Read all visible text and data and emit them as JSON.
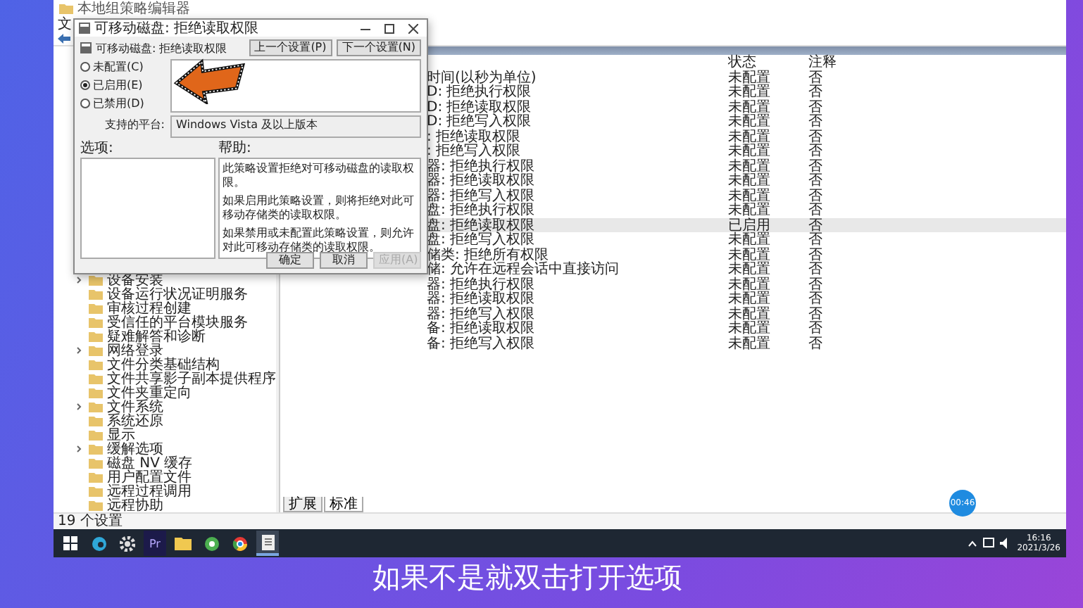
{
  "main_window": {
    "title": "本地组策略编辑器",
    "menu": [
      "文"
    ],
    "tree": [
      {
        "label": "设备安装",
        "expandable": true
      },
      {
        "label": "设备运行状况证明服务",
        "expandable": false
      },
      {
        "label": "审核过程创建",
        "expandable": false
      },
      {
        "label": "受信任的平台模块服务",
        "expandable": false
      },
      {
        "label": "疑难解答和诊断",
        "expandable": false
      },
      {
        "label": "网络登录",
        "expandable": true
      },
      {
        "label": "文件分类基础结构",
        "expandable": false
      },
      {
        "label": "文件共享影子副本提供程序",
        "expandable": false
      },
      {
        "label": "文件夹重定向",
        "expandable": false
      },
      {
        "label": "文件系统",
        "expandable": true
      },
      {
        "label": "系统还原",
        "expandable": false
      },
      {
        "label": "显示",
        "expandable": false
      },
      {
        "label": "缓解选项",
        "expandable": true
      },
      {
        "label": "磁盘 NV 缓存",
        "expandable": false
      },
      {
        "label": "用户配置文件",
        "expandable": false
      },
      {
        "label": "远程过程调用",
        "expandable": false
      },
      {
        "label": "远程协助",
        "expandable": false
      }
    ],
    "table": {
      "columns": [
        "状态",
        "注释"
      ],
      "rows": [
        {
          "setting": "时间(以秒为单位)",
          "state": "未配置",
          "comment": "否",
          "selected": false
        },
        {
          "setting": "D: 拒绝执行权限",
          "state": "未配置",
          "comment": "否",
          "selected": false
        },
        {
          "setting": "D: 拒绝读取权限",
          "state": "未配置",
          "comment": "否",
          "selected": false
        },
        {
          "setting": "D: 拒绝写入权限",
          "state": "未配置",
          "comment": "否",
          "selected": false
        },
        {
          "setting": ": 拒绝读取权限",
          "state": "未配置",
          "comment": "否",
          "selected": false
        },
        {
          "setting": ": 拒绝写入权限",
          "state": "未配置",
          "comment": "否",
          "selected": false
        },
        {
          "setting": "器: 拒绝执行权限",
          "state": "未配置",
          "comment": "否",
          "selected": false
        },
        {
          "setting": "器: 拒绝读取权限",
          "state": "未配置",
          "comment": "否",
          "selected": false
        },
        {
          "setting": "器: 拒绝写入权限",
          "state": "未配置",
          "comment": "否",
          "selected": false
        },
        {
          "setting": "盘: 拒绝执行权限",
          "state": "未配置",
          "comment": "否",
          "selected": false
        },
        {
          "setting": "盘: 拒绝读取权限",
          "state": "已启用",
          "comment": "否",
          "selected": true
        },
        {
          "setting": "盘: 拒绝写入权限",
          "state": "未配置",
          "comment": "否",
          "selected": false
        },
        {
          "setting": "储类: 拒绝所有权限",
          "state": "未配置",
          "comment": "否",
          "selected": false
        },
        {
          "setting": "储: 允许在远程会话中直接访问",
          "state": "未配置",
          "comment": "否",
          "selected": false
        },
        {
          "setting": "器: 拒绝执行权限",
          "state": "未配置",
          "comment": "否",
          "selected": false
        },
        {
          "setting": "器: 拒绝读取权限",
          "state": "未配置",
          "comment": "否",
          "selected": false
        },
        {
          "setting": "器: 拒绝写入权限",
          "state": "未配置",
          "comment": "否",
          "selected": false
        },
        {
          "setting": "备: 拒绝读取权限",
          "state": "未配置",
          "comment": "否",
          "selected": false
        },
        {
          "setting": "备: 拒绝写入权限",
          "state": "未配置",
          "comment": "否",
          "selected": false
        }
      ]
    },
    "view_tabs": [
      {
        "label": "扩展",
        "selected": false
      },
      {
        "label": "标准",
        "selected": true
      }
    ],
    "status_bar": "19 个设置"
  },
  "dialog": {
    "title": "可移动磁盘: 拒绝读取权限",
    "heading": "可移动磁盘: 拒绝读取权限",
    "nav_buttons": [
      "上一个设置(P)",
      "下一个设置(N)"
    ],
    "options": [
      {
        "label": "未配置(C)",
        "selected": false
      },
      {
        "label": "已启用(E)",
        "selected": true
      },
      {
        "label": "已禁用(D)",
        "selected": false
      }
    ],
    "platform_label": "支持的平台:",
    "platform": "Windows Vista 及以上版本",
    "options_label": "选项:",
    "help_label": "帮助:",
    "help": [
      "此策略设置拒绝对可移动磁盘的读取权限。",
      "如果启用此策略设置，则将拒绝对此可移动存储类的读取权限。",
      "如果禁用或未配置此策略设置，则允许对此可移动存储类的读取权限。"
    ],
    "buttons": [
      {
        "label": "确定",
        "disabled": false
      },
      {
        "label": "取消",
        "disabled": false
      },
      {
        "label": "应用(A)",
        "disabled": true
      }
    ]
  },
  "timer_badge": "00:46",
  "taskbar": {
    "apps": [
      {
        "kind": "start",
        "selected": false
      },
      {
        "kind": "browser",
        "selected": false
      },
      {
        "kind": "gear",
        "selected": false
      },
      {
        "kind": "text",
        "label": "Pr",
        "selected": false
      },
      {
        "kind": "folder",
        "selected": false
      },
      {
        "kind": "green",
        "selected": false
      },
      {
        "kind": "chrome",
        "selected": false
      },
      {
        "kind": "doc",
        "selected": true
      }
    ],
    "time": "16:16",
    "date": "2021/3/26"
  },
  "subtitle": "如果不是就双击打开选项"
}
